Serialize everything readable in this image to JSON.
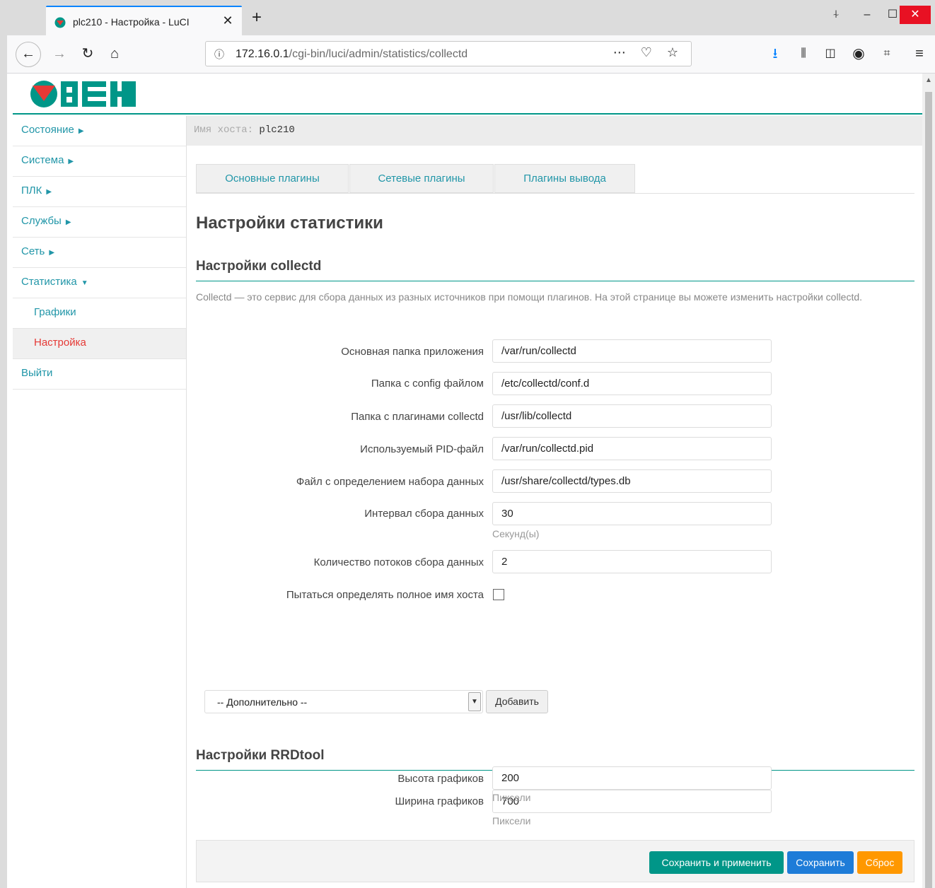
{
  "browser": {
    "tab_title": "plc210 - Настройка - LuCI",
    "url_host": "172.16.0.1",
    "url_path": "/cgi-bin/luci/admin/statistics/collectd"
  },
  "host": {
    "label": "Имя хоста:",
    "value": "plc210"
  },
  "sidebar": {
    "items": [
      {
        "label": "Состояние"
      },
      {
        "label": "Система"
      },
      {
        "label": "ПЛК"
      },
      {
        "label": "Службы"
      },
      {
        "label": "Сеть"
      },
      {
        "label": "Статистика"
      },
      {
        "label": "Графики"
      },
      {
        "label": "Настройка"
      },
      {
        "label": "Выйти"
      }
    ]
  },
  "tabs": [
    {
      "label": "Основные плагины"
    },
    {
      "label": "Сетевые плагины"
    },
    {
      "label": "Плагины вывода"
    }
  ],
  "page_title": "Настройки статистики",
  "collectd": {
    "title": "Настройки collectd",
    "description": "Collectd — это сервис для сбора данных из разных источников при помощи плагинов. На этой странице вы можете изменить настройки collectd.",
    "fields": [
      {
        "label": "Основная папка приложения",
        "value": "/var/run/collectd"
      },
      {
        "label": "Папка с config файлом",
        "value": "/etc/collectd/conf.d"
      },
      {
        "label": "Папка с плагинами collectd",
        "value": "/usr/lib/collectd"
      },
      {
        "label": "Используемый PID-файл",
        "value": "/var/run/collectd.pid"
      },
      {
        "label": "Файл с определением набора данных",
        "value": "/usr/share/collectd/types.db"
      },
      {
        "label": "Интервал сбора данных",
        "value": "30",
        "hint": "Секунд(ы)"
      },
      {
        "label": "Количество потоков сбора данных",
        "value": "2"
      }
    ],
    "fqdn_label": "Пытаться определять полное имя хоста",
    "additional_select": "-- Дополнительно --",
    "add_button": "Добавить"
  },
  "rrdtool": {
    "title": "Настройки RRDtool",
    "fields": [
      {
        "label": "Ширина графиков",
        "value": "700",
        "hint": "Пиксели"
      },
      {
        "label": "Высота графиков",
        "value": "200",
        "hint": "Пиксели"
      }
    ]
  },
  "actions": {
    "save_apply": "Сохранить и применить",
    "save": "Сохранить",
    "reset": "Сброс"
  },
  "colors": {
    "accent": "#009688",
    "link": "#2196a8",
    "active": "#e53935",
    "save": "#1e7cd8",
    "reset": "#ff9800"
  }
}
